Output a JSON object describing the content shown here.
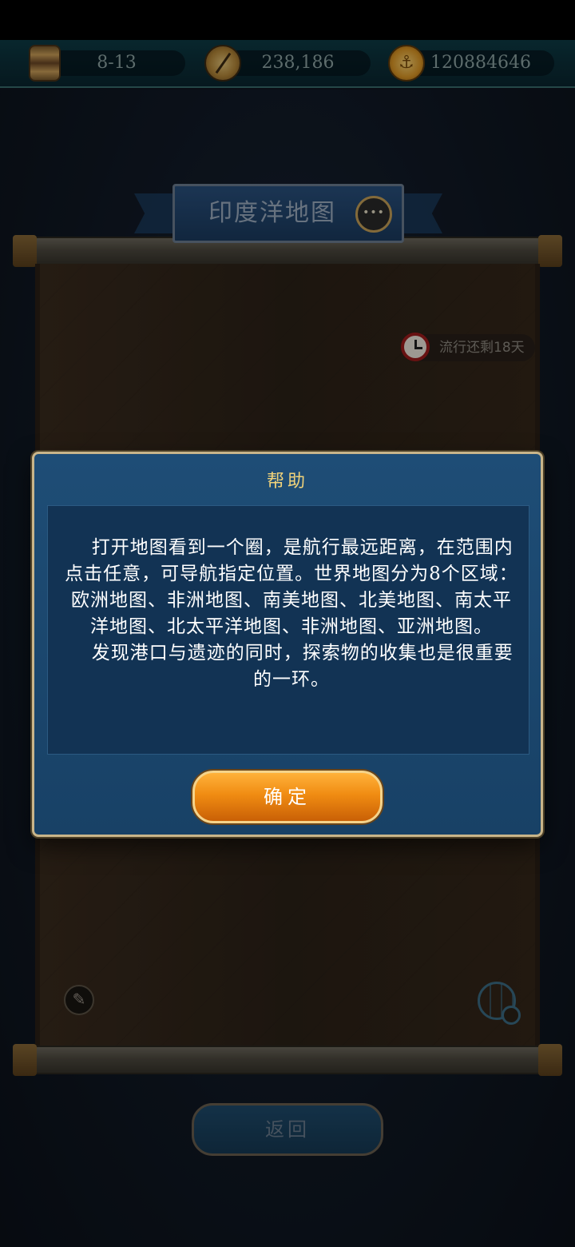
{
  "resources": {
    "date": "8-13",
    "compass_value": "238,186",
    "gold": "120884646"
  },
  "map": {
    "title": "印度洋地图",
    "voyage_timer": "流行还剩18天"
  },
  "help_dialog": {
    "title": "帮助",
    "paragraph_1": "打开地图看到一个圈，是航行最远距离，在范围内点击任意，可导航指定位置。世界地图分为8个区域：欧洲地图、非洲地图、南美地图、北美地图、南太平洋地图、北太平洋地图、非洲地图、亚洲地图。",
    "paragraph_2": "发现港口与遗迹的同时，探索物的收集也是很重要的一环。",
    "confirm_label": "确定"
  },
  "footer": {
    "back_label": "返回"
  }
}
